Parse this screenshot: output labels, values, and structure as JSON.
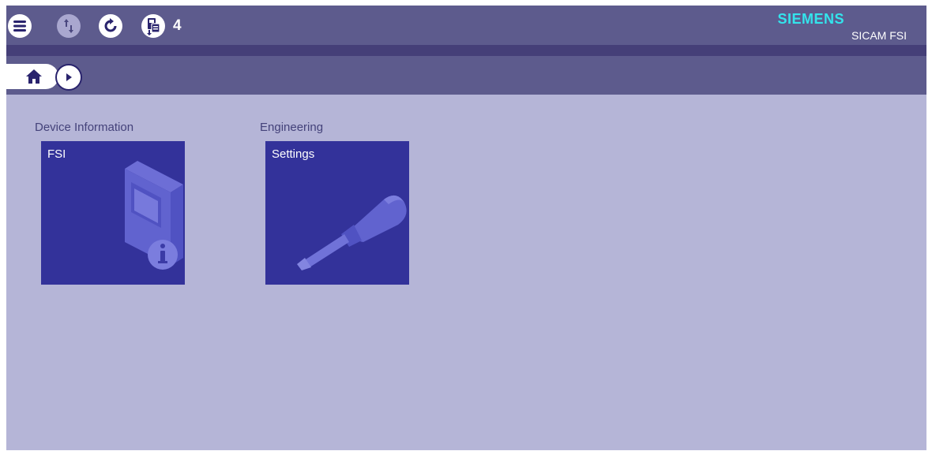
{
  "header": {
    "brand": "SIEMENS",
    "product": "SICAM FSI",
    "pending_count": "4",
    "icons": [
      "menu-icon",
      "upload-download-icon",
      "refresh-icon",
      "device-queue-icon"
    ]
  },
  "nav": {
    "home_icon": "home-icon",
    "next_icon": "chevron-right-icon"
  },
  "sections": [
    {
      "title": "Device Information",
      "tile": {
        "label": "FSI",
        "icon": "device-info-icon"
      }
    },
    {
      "title": "Engineering",
      "tile": {
        "label": "Settings",
        "icon": "screwdriver-icon"
      }
    }
  ],
  "colors": {
    "accent": "#33e4ec",
    "header": "#5d5b8d",
    "header_strip": "#453f78",
    "content": "#b5b5d7",
    "tile": "#33329a",
    "icon_dark": "#29236d"
  }
}
